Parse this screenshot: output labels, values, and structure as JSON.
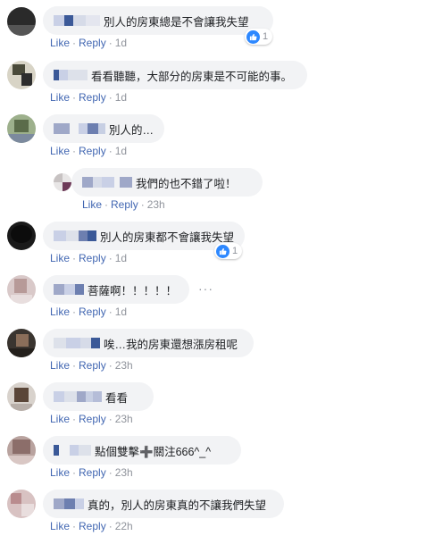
{
  "labels": {
    "like": "Like",
    "reply": "Reply",
    "separator": "·"
  },
  "colors": {
    "link": "#4267b2",
    "bubble": "#f2f3f5",
    "reaction_like": "#2d88ff"
  },
  "comments": [
    {
      "text": "別人的房東總是不會讓我失望",
      "time": "1d",
      "reactions": "1",
      "reaction_icon": "like-icon"
    },
    {
      "text": "看看聽聽，大部分的房東是不可能的事。",
      "time": "1d"
    },
    {
      "text": "別人的…",
      "time": "1d"
    },
    {
      "text": "我們的也不錯了啦！",
      "time": "23h"
    },
    {
      "text": "別人的房東都不會讓我失望",
      "time": "1d",
      "reactions": "1",
      "reaction_icon": "like-icon"
    },
    {
      "text": "菩薩啊！！！！！",
      "time": "1d",
      "more": "···"
    },
    {
      "text": "唉…我的房東還想漲房租呢",
      "time": "23h"
    },
    {
      "text": "看看",
      "time": "23h"
    },
    {
      "text": "點個雙擊➕關注666^_^",
      "time": "23h"
    },
    {
      "text": "真的，別人的房東真的不讓我們失望",
      "time": "22h"
    }
  ]
}
